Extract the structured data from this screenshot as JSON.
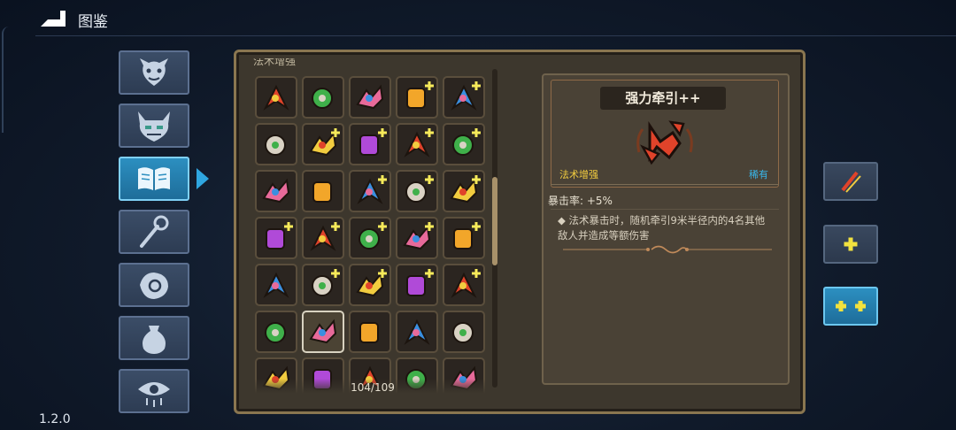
{
  "header": {
    "title": "图鉴",
    "back_icon": "back-arrow-icon"
  },
  "version": "1.2.0",
  "sidebar": {
    "items": [
      {
        "icon": "monster-face-icon",
        "active": false
      },
      {
        "icon": "horned-demon-icon",
        "active": false
      },
      {
        "icon": "open-book-icon",
        "active": true
      },
      {
        "icon": "staff-icon",
        "active": false
      },
      {
        "icon": "spell-hand-icon",
        "active": false
      },
      {
        "icon": "pouch-icon",
        "active": false
      },
      {
        "icon": "eye-icon",
        "active": false
      }
    ]
  },
  "grid": {
    "category_label": "法术增强",
    "counter": "104/109",
    "selected_index": 26,
    "items": [
      "arrows-up-icon",
      "slash-icon",
      "triple-slash-icon",
      "burst-plus-icon",
      "drop-plus-icon",
      "crossed-sword-icon",
      "lightning-plus-icon",
      "pause-plus-icon",
      "moon-plus-icon",
      "mouse-plus-icon",
      "crosshair-icon",
      "zigzag-arrow-icon",
      "tri-arrow-plus-icon",
      "crystal-plus-icon",
      "scroll-plus-icon",
      "bolt-plus-icon",
      "up-arrows-plus-icon",
      "clock-plus-icon",
      "battery-plus-icon",
      "reticle-plus-icon",
      "chevrons-icon",
      "sun-plus-icon",
      "potion-plus-icon",
      "cube-plus-icon",
      "worm-plus-icon",
      "flame-ring-icon",
      "pull-arrows-icon",
      "vortex-cross-icon",
      "orbit-icon",
      "spiral-icon",
      "partial-1-icon",
      "partial-2-icon",
      "partial-3-icon",
      "partial-4-icon",
      "partial-5-icon"
    ]
  },
  "detail": {
    "name": "强力牵引++",
    "category": "法术增强",
    "rarity": "稀有",
    "stat": "暴击率: +5%",
    "description": "◆ 法术暴击时，随机牵引9米半径内的4名其他敌人并造成等额伤害",
    "icon": "pull-arrows-icon"
  },
  "right_buttons": [
    {
      "icon": "slash-upgrade-icon",
      "active": false
    },
    {
      "icon": "single-plus-icon",
      "active": false
    },
    {
      "icon": "double-plus-icon",
      "active": true
    }
  ],
  "colors": {
    "accent_blue": "#2c8fc0",
    "gold": "#f2cc3f",
    "rarity_blue": "#38b6ea",
    "panel_border": "#8a7650"
  }
}
